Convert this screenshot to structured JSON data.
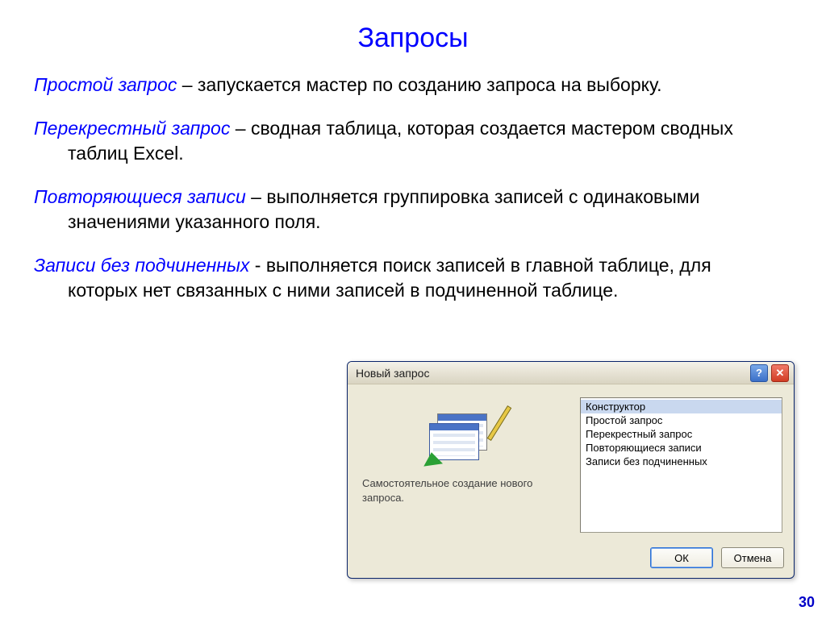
{
  "title": "Запросы",
  "entries": [
    {
      "term": "Простой запрос",
      "sep": " – ",
      "desc": "запускается мастер по созданию запроса на выборку."
    },
    {
      "term": "Перекрестный запрос",
      "sep": " – ",
      "desc": "сводная таблица, которая создается мастером сводных таблиц Excel."
    },
    {
      "term": "Повторяющиеся записи",
      "sep": " – ",
      "desc": "выполняется группировка записей с одинаковыми значениями указанного поля."
    },
    {
      "term": "Записи без подчиненных",
      "sep": " - ",
      "desc": "выполняется поиск записей в главной таблице, для которых нет связанных с ними записей в подчиненной таблице."
    }
  ],
  "dialog": {
    "title": "Новый запрос",
    "help_glyph": "?",
    "close_glyph": "✕",
    "description": "Самостоятельное создание нового запроса.",
    "list": [
      "Конструктор",
      "Простой запрос",
      "Перекрестный запрос",
      "Повторяющиеся записи",
      "Записи без подчиненных"
    ],
    "selected_index": 0,
    "ok_label": "ОК",
    "cancel_label": "Отмена"
  },
  "page_number": "30"
}
